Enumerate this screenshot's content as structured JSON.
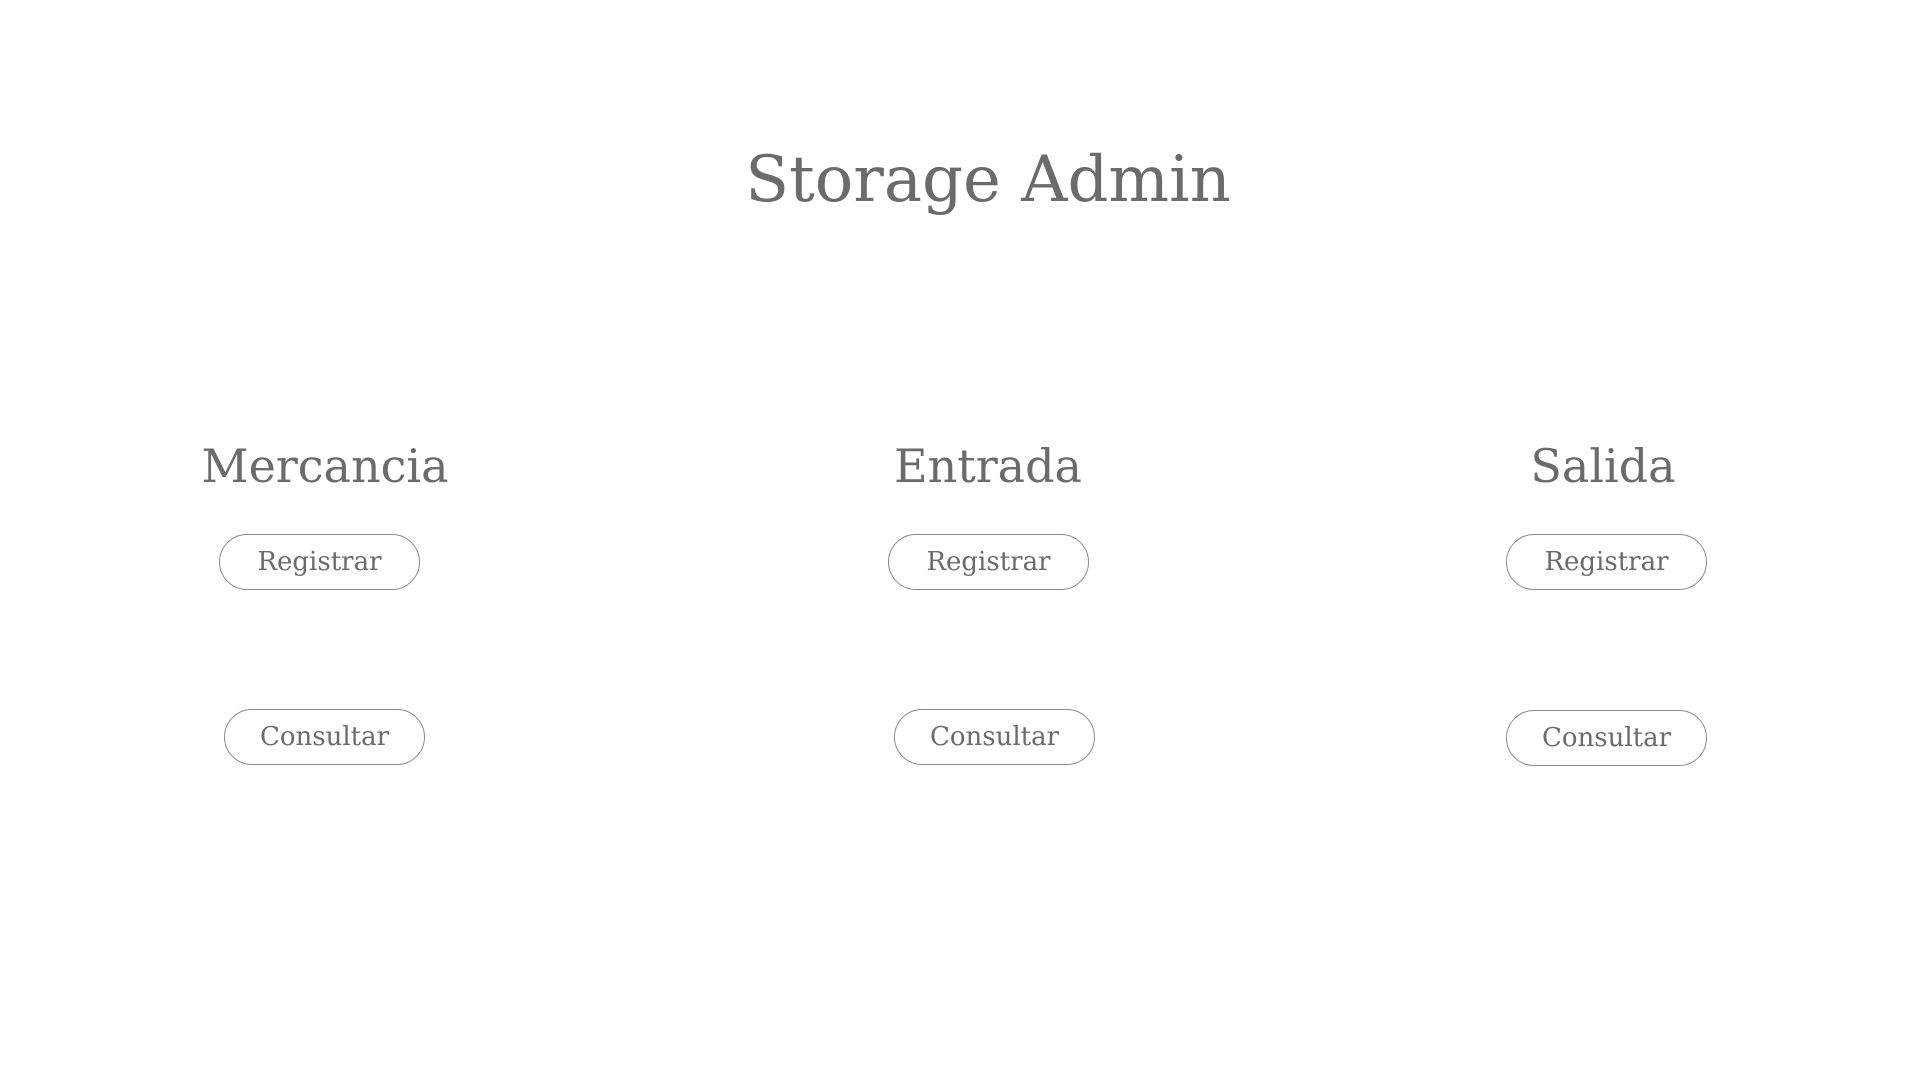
{
  "page": {
    "title": "Storage Admin"
  },
  "sections": [
    {
      "title": "Mercancia",
      "register_label": "Registrar",
      "consult_label": "Consultar"
    },
    {
      "title": "Entrada",
      "register_label": "Registrar",
      "consult_label": "Consultar"
    },
    {
      "title": "Salida",
      "register_label": "Registrar",
      "consult_label": "Consultar"
    }
  ],
  "colors": {
    "text": "#6b6b6b",
    "button_border": "#8a8a8a",
    "background": "#ffffff"
  }
}
